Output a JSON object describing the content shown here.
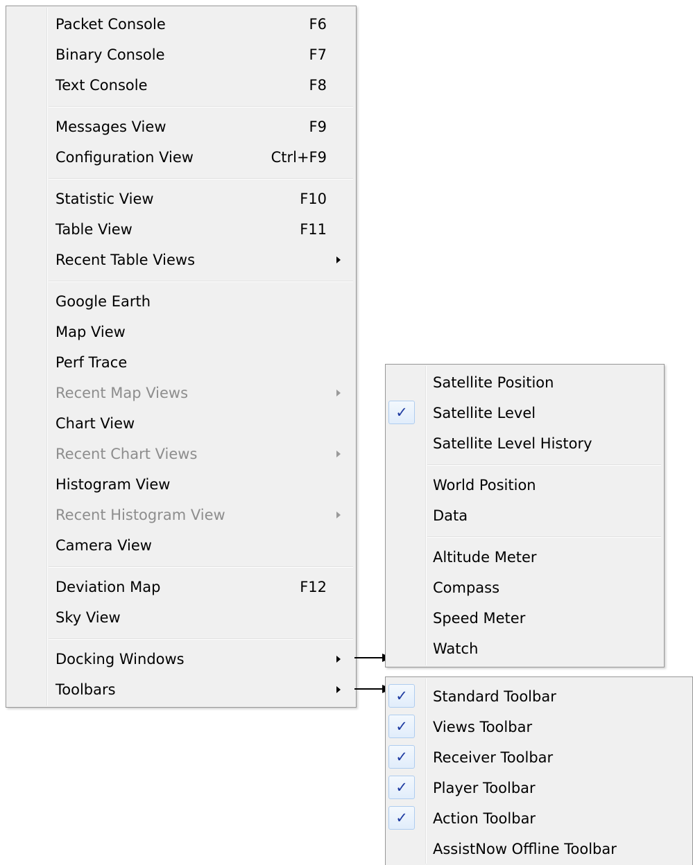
{
  "main_menu": {
    "items": [
      {
        "label": "Packet Console",
        "shortcut": "F6"
      },
      {
        "label": "Binary Console",
        "shortcut": "F7"
      },
      {
        "label": "Text Console",
        "shortcut": "F8"
      },
      {
        "label": "Messages View",
        "shortcut": "F9"
      },
      {
        "label": "Configuration View",
        "shortcut": "Ctrl+F9"
      },
      {
        "label": "Statistic View",
        "shortcut": "F10"
      },
      {
        "label": "Table View",
        "shortcut": "F11"
      },
      {
        "label": "Recent Table Views",
        "shortcut": ""
      },
      {
        "label": "Google Earth",
        "shortcut": ""
      },
      {
        "label": "Map View",
        "shortcut": ""
      },
      {
        "label": "Perf Trace",
        "shortcut": ""
      },
      {
        "label": "Recent Map Views",
        "shortcut": ""
      },
      {
        "label": "Chart View",
        "shortcut": ""
      },
      {
        "label": "Recent Chart Views",
        "shortcut": ""
      },
      {
        "label": "Histogram View",
        "shortcut": ""
      },
      {
        "label": "Recent Histogram View",
        "shortcut": ""
      },
      {
        "label": "Camera View",
        "shortcut": ""
      },
      {
        "label": "Deviation Map",
        "shortcut": "F12"
      },
      {
        "label": "Sky View",
        "shortcut": ""
      },
      {
        "label": "Docking Windows",
        "shortcut": ""
      },
      {
        "label": "Toolbars",
        "shortcut": ""
      }
    ]
  },
  "docking_windows_submenu": {
    "items": [
      {
        "label": "Satellite Position",
        "checked": false
      },
      {
        "label": "Satellite Level",
        "checked": true
      },
      {
        "label": "Satellite Level History",
        "checked": false
      },
      {
        "label": "World Position",
        "checked": false
      },
      {
        "label": "Data",
        "checked": false
      },
      {
        "label": "Altitude Meter",
        "checked": false
      },
      {
        "label": "Compass",
        "checked": false
      },
      {
        "label": "Speed Meter",
        "checked": false
      },
      {
        "label": "Watch",
        "checked": false
      }
    ]
  },
  "toolbars_submenu": {
    "items": [
      {
        "label": "Standard Toolbar",
        "checked": true
      },
      {
        "label": "Views Toolbar",
        "checked": true
      },
      {
        "label": "Receiver Toolbar",
        "checked": true
      },
      {
        "label": "Player Toolbar",
        "checked": true
      },
      {
        "label": "Action Toolbar",
        "checked": true
      },
      {
        "label": "AssistNow Offline Toolbar",
        "checked": false
      }
    ]
  },
  "check_glyph": "✓",
  "colors": {
    "menu_bg": "#f0f0f0",
    "menu_border": "#979797",
    "disabled_text": "#8d8d8d",
    "check_color": "#1d3aa0",
    "check_box_border": "#aeccef"
  },
  "icons": {
    "submenu_arrow": "chevron-right-icon",
    "check": "checkmark-icon",
    "connector": "arrow-right-icon"
  }
}
